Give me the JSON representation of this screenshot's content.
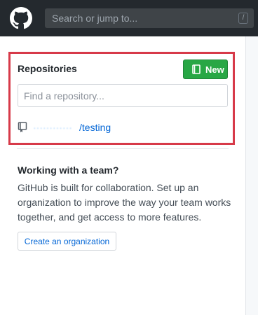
{
  "header": {
    "search_placeholder": "Search or jump to...",
    "search_shortcut": "/"
  },
  "repositories": {
    "title": "Repositories",
    "new_button": "New",
    "filter_placeholder": "Find a repository...",
    "items": [
      {
        "owner": "············",
        "separator_name": "/testing"
      }
    ]
  },
  "team": {
    "title": "Working with a team?",
    "description": "GitHub is built for collaboration. Set up an organization to improve the way your team works together, and get access to more features.",
    "button": "Create an organization"
  },
  "colors": {
    "header_bg": "#24292e",
    "highlight_border": "#d73a49",
    "new_button_bg": "#28a745",
    "link": "#0366d6"
  },
  "icons": [
    "github-logo-icon",
    "book-icon",
    "repo-icon"
  ]
}
